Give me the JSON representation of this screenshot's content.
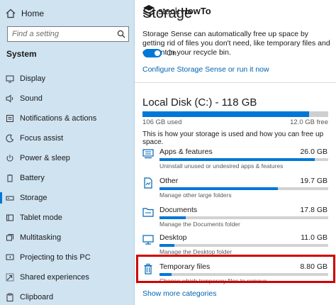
{
  "sidebar": {
    "home_label": "Home",
    "search_placeholder": "Find a setting",
    "section_title": "System",
    "items": [
      {
        "label": "Display",
        "icon": "display-icon"
      },
      {
        "label": "Sound",
        "icon": "speaker-icon"
      },
      {
        "label": "Notifications & actions",
        "icon": "notifications-icon"
      },
      {
        "label": "Focus assist",
        "icon": "moon-icon"
      },
      {
        "label": "Power & sleep",
        "icon": "power-icon"
      },
      {
        "label": "Battery",
        "icon": "battery-icon"
      },
      {
        "label": "Storage",
        "icon": "storage-icon",
        "active": true
      },
      {
        "label": "Tablet mode",
        "icon": "tablet-icon"
      },
      {
        "label": "Multitasking",
        "icon": "multitasking-icon"
      },
      {
        "label": "Projecting to this PC",
        "icon": "projecting-icon"
      },
      {
        "label": "Shared experiences",
        "icon": "shared-icon"
      },
      {
        "label": "Clipboard",
        "icon": "clipboard-icon"
      }
    ]
  },
  "main": {
    "title": "Storage",
    "brand": {
      "part1": "stack",
      "part2": "HowTo"
    },
    "description": "Storage Sense can automatically free up space by getting rid of files you don't need, like temporary files and content in your recycle bin.",
    "toggle": {
      "label": "On",
      "state": true
    },
    "configure_link": "Configure Storage Sense or run it now",
    "disk": {
      "title": "Local Disk (C:) - 118 GB",
      "used_label": "106 GB used",
      "free_label": "12.0 GB free",
      "used_fraction": 0.898
    },
    "how_text": "This is how your storage is used and how you can free up space.",
    "categories": [
      {
        "name": "Apps & features",
        "size": "26.0 GB",
        "sub": "Uninstall unused or undesired apps & features",
        "fraction": 0.92,
        "icon": "apps-icon"
      },
      {
        "name": "Other",
        "size": "19.7 GB",
        "sub": "Manage other large folders",
        "fraction": 0.7,
        "icon": "other-icon"
      },
      {
        "name": "Documents",
        "size": "17.8 GB",
        "sub": "Manage the Documents folder",
        "fraction": 0.155,
        "icon": "documents-icon"
      },
      {
        "name": "Desktop",
        "size": "11.0 GB",
        "sub": "Manage the Desktop folder",
        "fraction": 0.09,
        "icon": "desktop-icon"
      },
      {
        "name": "Temporary files",
        "size": "8.80 GB",
        "sub": "Choose which temporary files to remove",
        "fraction": 0.07,
        "icon": "trash-icon"
      }
    ],
    "more_link": "Show more categories"
  },
  "colors": {
    "accent": "#0078d7",
    "sidebar_bg": "#cfe3f1",
    "link": "#0063b1",
    "highlight": "#d10000"
  }
}
